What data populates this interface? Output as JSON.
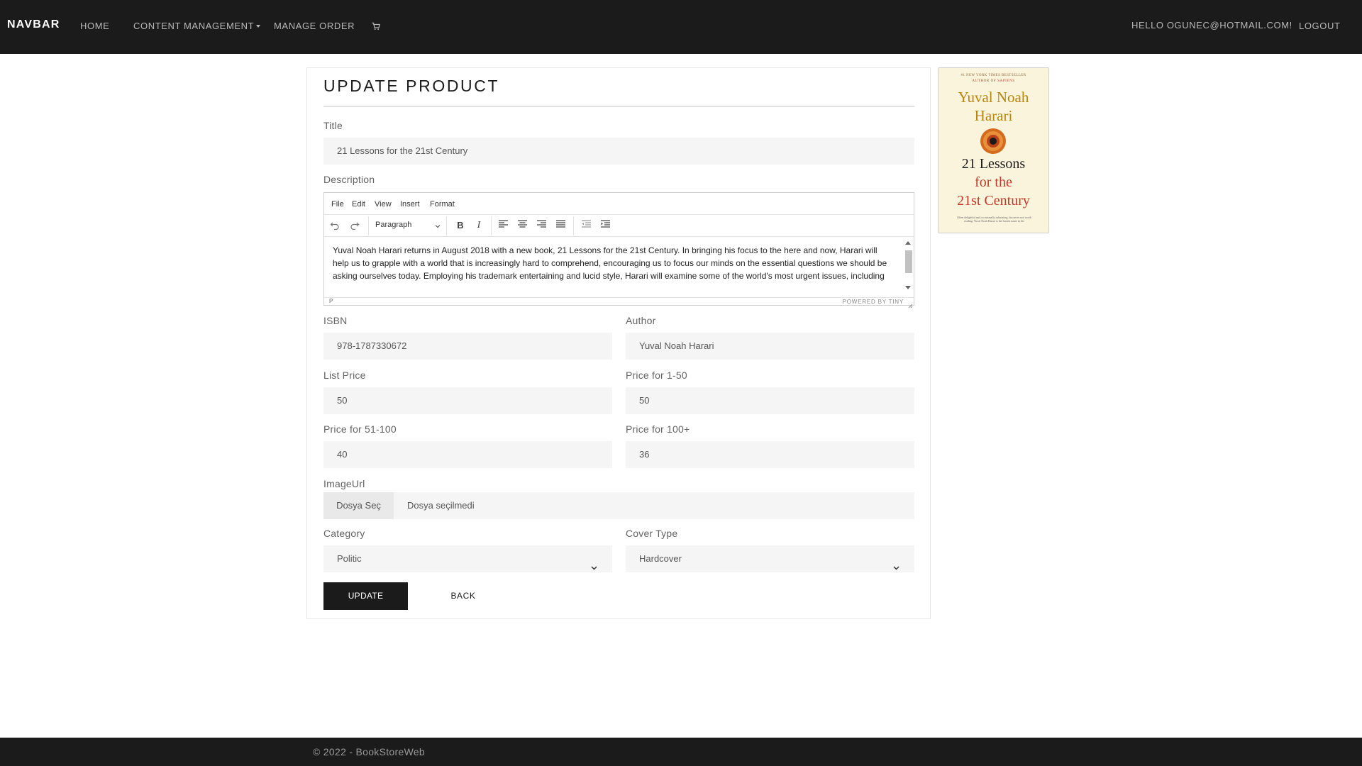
{
  "navbar": {
    "brand": "NAVBAR",
    "home": "HOME",
    "content_management": "CONTENT MANAGEMENT",
    "manage_order": "MANAGE ORDER",
    "cart_icon": "cart-icon",
    "hello": "HELLO OGUNEC@HOTMAIL.COM!",
    "logout": "LOGOUT"
  },
  "form": {
    "heading": "UPDATE PRODUCT",
    "title_label": "Title",
    "title_value": "21 Lessons for the 21st Century",
    "description_label": "Description",
    "editor": {
      "menu": [
        "File",
        "Edit",
        "View",
        "Insert",
        "Format"
      ],
      "block_format": "Paragraph",
      "content": "Yuval Noah Harari returns in August 2018 with a new book, 21 Lessons for the 21st Century. In bringing his focus to the here and now, Harari will help us to grapple with a world that is increasingly hard to comprehend, encouraging us to focus our minds on the essential questions we should be asking ourselves today. Employing his trademark entertaining and lucid style, Harari will examine some of the world's most urgent issues, including terrorism, fake news and immigration, as well as turning to more individual concerns, from resilience",
      "status_path": "P",
      "powered_by": "POWERED BY TINY"
    },
    "isbn_label": "ISBN",
    "isbn_value": "978-1787330672",
    "author_label": "Author",
    "author_value": "Yuval Noah Harari",
    "list_price_label": "List Price",
    "list_price_value": "50",
    "price_1_50_label": "Price for 1-50",
    "price_1_50_value": "50",
    "price_51_100_label": "Price for 51-100",
    "price_51_100_value": "40",
    "price_100_label": "Price for 100+",
    "price_100_value": "36",
    "image_label": "ImageUrl",
    "file_button": "Dosya Seç",
    "file_status": "Dosya seçilmedi",
    "category_label": "Category",
    "category_value": "Politic",
    "cover_label": "Cover Type",
    "cover_value": "Hardcover",
    "update_button": "UPDATE",
    "back_button": "BACK"
  },
  "cover": {
    "top_line": "#1 NEW YORK TIMES BESTSELLER",
    "top_line2": "AUTHOR OF SAPIENS",
    "author_line1": "Yuval Noah",
    "author_line2": "Harari",
    "title_line1": "21 Lessons",
    "title_line2": "for the",
    "title_line3": "21st Century",
    "blurb": "Often delightful and occasionally infuriating, but never not worth reading. Yuval Noah Harari is the hottest name in the"
  },
  "footer": {
    "text": "© 2022 - BookStoreWeb"
  },
  "colors": {
    "navbar_bg": "#1b1b1b",
    "field_bg": "#f5f5f6",
    "primary_button": "#1b1b1b"
  }
}
